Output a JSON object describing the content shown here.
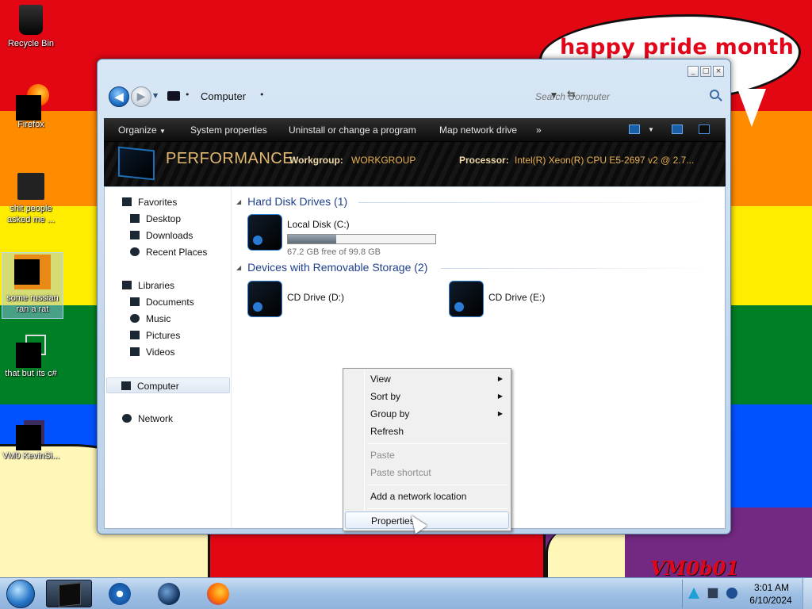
{
  "desktop": {
    "bubble_text": "happy pride month",
    "watermark": "VM0b01",
    "icons": [
      {
        "label": "Recycle Bin"
      },
      {
        "label": "Firefox"
      },
      {
        "label": "shit people asked me ..."
      },
      {
        "label": "some russian ran a rat"
      },
      {
        "label": "that but its c#"
      },
      {
        "label": "VM0 KevinSi..."
      }
    ]
  },
  "window": {
    "caption_buttons": [
      "_",
      "□",
      "×"
    ],
    "address": {
      "location": "Computer"
    },
    "search": {
      "placeholder": "Search Computer"
    },
    "toolbar": {
      "organize": "Organize",
      "system_properties": "System properties",
      "uninstall": "Uninstall or change a program",
      "map_drive": "Map network drive",
      "more": "»"
    },
    "details": {
      "title": "PERFORMANCE",
      "workgroup_label": "Workgroup:",
      "workgroup_value": "WORKGROUP",
      "processor_label": "Processor:",
      "processor_value": "Intel(R) Xeon(R) CPU E5-2697 v2 @ 2.7..."
    },
    "nav": {
      "favorites": "Favorites",
      "desktop": "Desktop",
      "downloads": "Downloads",
      "recent": "Recent Places",
      "libraries": "Libraries",
      "documents": "Documents",
      "music": "Music",
      "pictures": "Pictures",
      "videos": "Videos",
      "computer": "Computer",
      "network": "Network"
    },
    "groups": {
      "hdd_header": "Hard Disk Drives (1)",
      "removable_header": "Devices with Removable Storage (2)"
    },
    "drives": {
      "c": {
        "name": "Local Disk (C:)",
        "free_text": "67.2 GB free of 99.8 GB",
        "used_fraction": 0.327
      },
      "d": {
        "name": "CD Drive (D:)"
      },
      "e": {
        "name": "CD Drive (E:)"
      }
    }
  },
  "context_menu": {
    "view": "View",
    "sort_by": "Sort by",
    "group_by": "Group by",
    "refresh": "Refresh",
    "paste": "Paste",
    "paste_shortcut": "Paste shortcut",
    "add_network_location": "Add a network location",
    "properties": "Properties"
  },
  "taskbar": {
    "clock_time": "3:01 AM",
    "clock_date": "6/10/2024"
  }
}
